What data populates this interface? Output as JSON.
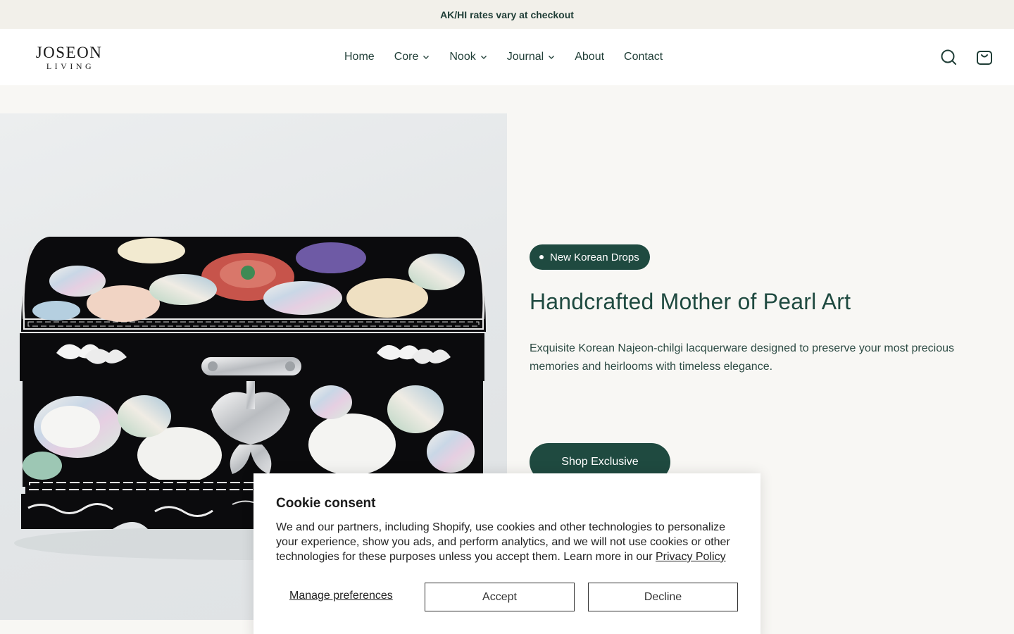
{
  "announcement": "AK/HI rates vary at checkout",
  "logo": {
    "line1": "JOSEON",
    "line2": "LIVING"
  },
  "nav": [
    {
      "label": "Home",
      "has_dropdown": false
    },
    {
      "label": "Core",
      "has_dropdown": true
    },
    {
      "label": "Nook",
      "has_dropdown": true
    },
    {
      "label": "Journal",
      "has_dropdown": true
    },
    {
      "label": "About",
      "has_dropdown": false
    },
    {
      "label": "Contact",
      "has_dropdown": false
    }
  ],
  "header_icons": [
    "search-icon",
    "cart-icon"
  ],
  "hero": {
    "badge": "New Korean Drops",
    "title": "Handcrafted Mother of Pearl Art",
    "description": "Exquisite Korean Najeon-chilgi lacquerware designed to preserve your most precious memories and heirlooms with timeless elegance.",
    "cta": "Shop Exclusive"
  },
  "cookie": {
    "title": "Cookie consent",
    "body": "We and our partners, including Shopify, use cookies and other technologies to personalize your experience, show you ads, and perform analytics, and we will not use cookies or other technologies for these purposes unless you accept them. Learn more in our ",
    "privacy_link": "Privacy Policy",
    "manage": "Manage preferences",
    "accept": "Accept",
    "decline": "Decline"
  },
  "colors": {
    "primary": "#1f4a40",
    "background": "#f8f7f4",
    "announcement_bg": "#f2f0ea"
  }
}
